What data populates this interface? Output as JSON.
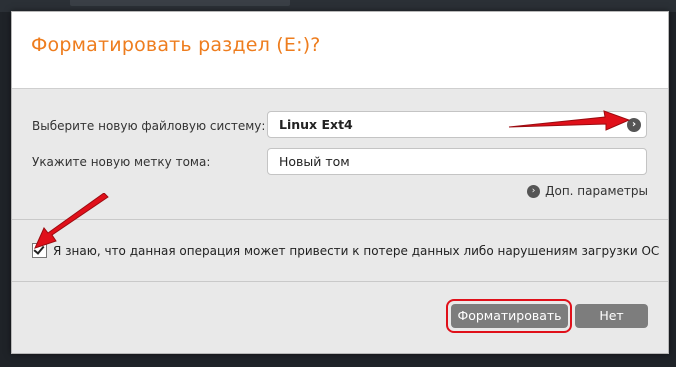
{
  "dialog": {
    "title": "Форматировать раздел (E:)?",
    "filesystem_label": "Выберите новую файловую систему:",
    "filesystem_value": "Linux Ext4",
    "volume_label_label": "Укажите новую метку тома:",
    "volume_label_value": "Новый том",
    "advanced_label": "Доп. параметры",
    "warning_text": "Я знаю, что данная операция может привести к потере данных либо нарушениям загрузки ОС",
    "warning_checked": true,
    "format_button": "Форматировать",
    "cancel_button": "Нет"
  },
  "colors": {
    "title": "#ee7d1e",
    "button": "#7d7d7d",
    "annotation": "#e0101a"
  },
  "icons": [
    "chevron-right-icon",
    "chevron-right-icon",
    "checkmark-icon",
    "red-arrow-annotation"
  ]
}
